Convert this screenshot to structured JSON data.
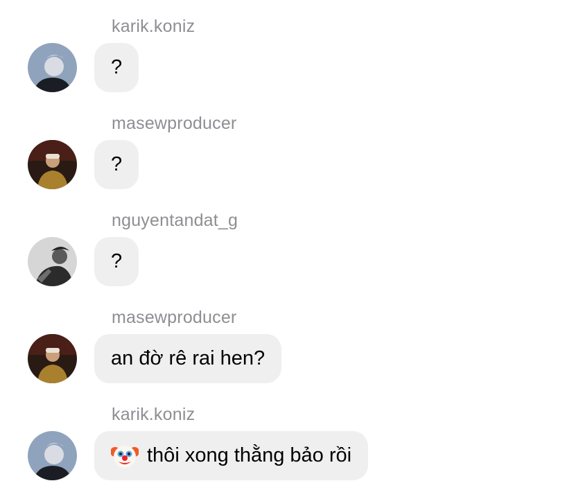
{
  "messages": [
    {
      "sender": "karik.koniz",
      "avatar": "avatar-karik",
      "text": "?"
    },
    {
      "sender": "masewproducer",
      "avatar": "avatar-masew",
      "text": "?"
    },
    {
      "sender": "nguyentandat_g",
      "avatar": "avatar-nguyentandat",
      "text": "?"
    },
    {
      "sender": "masewproducer",
      "avatar": "avatar-masew",
      "text": "an đờ rê rai hen?"
    },
    {
      "sender": "karik.koniz",
      "avatar": "avatar-karik",
      "emoji": "clown-face-icon",
      "text": "thôi xong thằng bảo rồi"
    }
  ],
  "colors": {
    "bubble": "#efeff0",
    "sender": "#8e8e93",
    "text": "#000000"
  }
}
